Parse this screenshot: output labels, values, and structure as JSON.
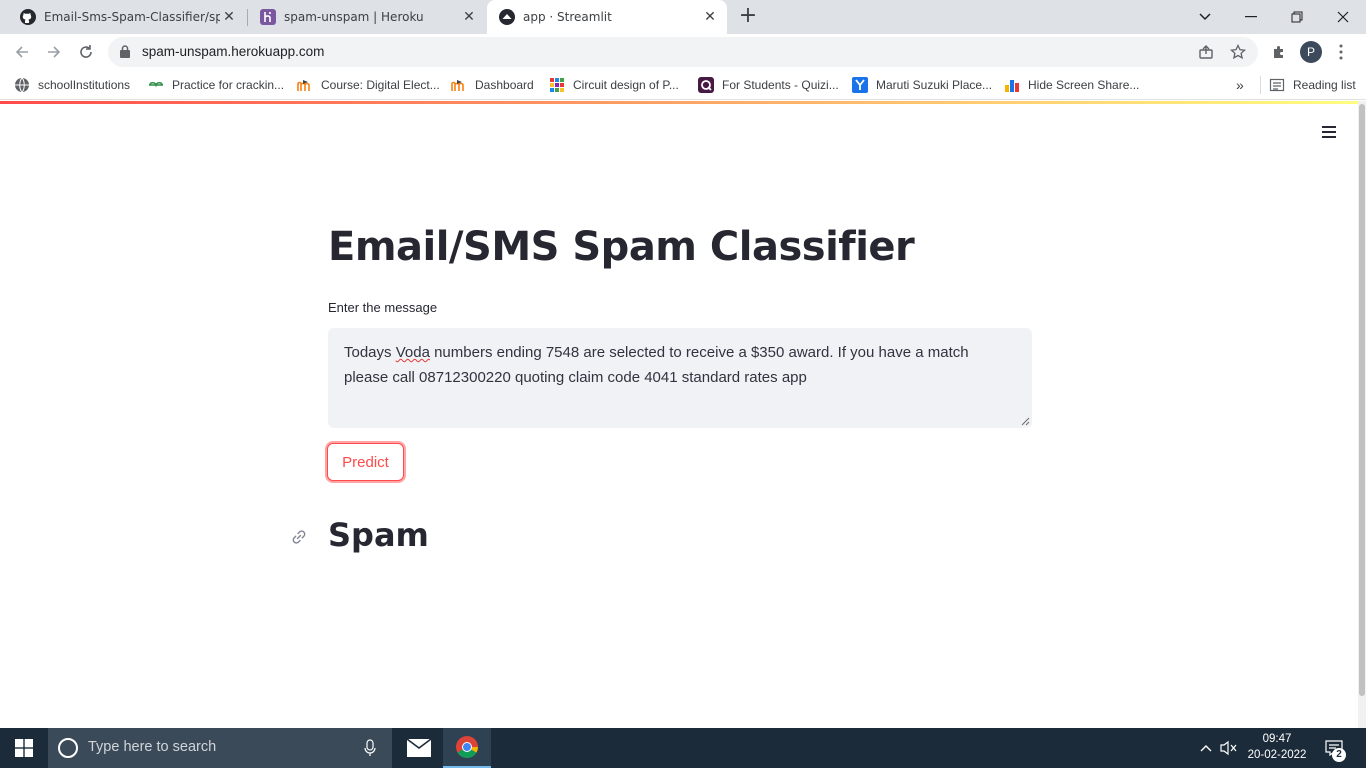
{
  "browser": {
    "tabs": [
      {
        "title": "Email-Sms-Spam-Classifier/spam",
        "icon": "github-icon",
        "active": false
      },
      {
        "title": "spam-unspam | Heroku",
        "icon": "heroku-icon",
        "active": false
      },
      {
        "title": "app · Streamlit",
        "icon": "streamlit-icon",
        "active": true
      }
    ],
    "url": "spam-unspam.herokuapp.com",
    "profile_initial": "P",
    "bookmarks": [
      {
        "label": "schoolInstitutions",
        "icon": "globe-icon"
      },
      {
        "label": "Practice for crackin...",
        "icon": "gfg-icon"
      },
      {
        "label": "Course: Digital Elect...",
        "icon": "moodle-icon"
      },
      {
        "label": "Dashboard",
        "icon": "moodle-icon"
      },
      {
        "label": "Circuit design  of P...",
        "icon": "grid-icon"
      },
      {
        "label": "For Students - Quizi...",
        "icon": "quizizz-icon"
      },
      {
        "label": "Maruti Suzuki Place...",
        "icon": "y-icon"
      },
      {
        "label": "Hide Screen Share...",
        "icon": "chart-icon"
      }
    ],
    "bookmarks_overflow": "»",
    "reading_list": "Reading list"
  },
  "app": {
    "title": "Email/SMS Spam Classifier",
    "input_label": "Enter the message",
    "message_before": "Todays ",
    "message_misspelled": "Voda",
    "message_after": " numbers ending 7548 are selected to receive a $350 award. If you have a match please call 08712300220 quoting claim code 4041 standard rates app",
    "predict_label": "Predict",
    "result": "Spam",
    "accent_color": "#ff4b4b"
  },
  "taskbar": {
    "search_placeholder": "Type here to search",
    "time": "09:47",
    "date": "20-02-2022",
    "notification_count": "2"
  }
}
